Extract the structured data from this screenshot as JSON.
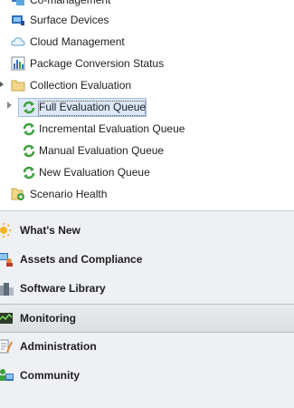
{
  "tree": {
    "items": [
      {
        "label": "Co-management",
        "icon": "co-management-icon"
      },
      {
        "label": "Surface Devices",
        "icon": "surface-devices-icon"
      },
      {
        "label": "Cloud Management",
        "icon": "cloud-icon"
      },
      {
        "label": "Package Conversion Status",
        "icon": "bar-chart-icon"
      },
      {
        "label": "Collection Evaluation",
        "icon": "folder-icon"
      },
      {
        "label": "Full Evaluation Queue",
        "icon": "refresh-queue-icon"
      },
      {
        "label": "Incremental Evaluation Queue",
        "icon": "refresh-queue-icon"
      },
      {
        "label": "Manual Evaluation Queue",
        "icon": "refresh-queue-icon"
      },
      {
        "label": "New Evaluation Queue",
        "icon": "refresh-queue-icon"
      },
      {
        "label": "Scenario Health",
        "icon": "scenario-health-icon"
      }
    ],
    "selected": "Full Evaluation Queue"
  },
  "workspaces": [
    {
      "label": "What's New",
      "icon": "starburst-icon"
    },
    {
      "label": "Assets and Compliance",
      "icon": "assets-icon"
    },
    {
      "label": "Software Library",
      "icon": "software-library-icon"
    },
    {
      "label": "Monitoring",
      "icon": "monitoring-icon",
      "active": true
    },
    {
      "label": "Administration",
      "icon": "administration-icon"
    },
    {
      "label": "Community",
      "icon": "community-icon"
    }
  ]
}
